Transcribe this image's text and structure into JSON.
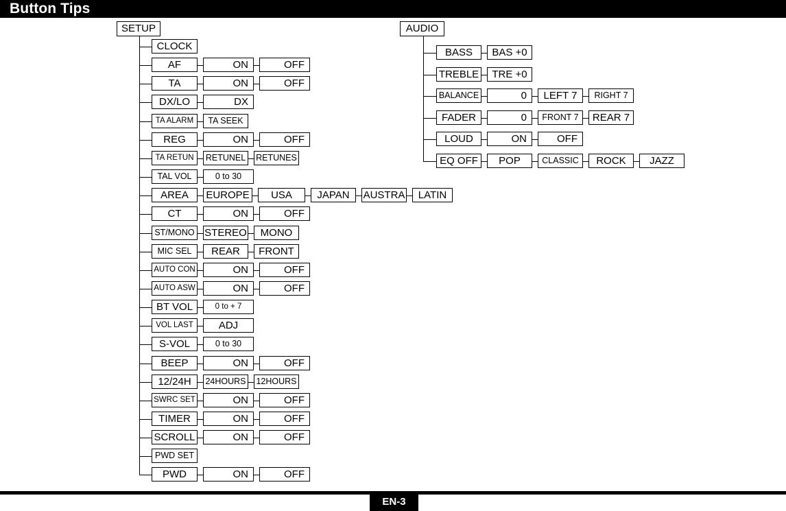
{
  "header": {
    "title": "Button Tips"
  },
  "footer": {
    "page_label": "EN-3"
  },
  "colors": {
    "ink": "#000000",
    "paper": "#ffffff"
  },
  "setup_tree": {
    "root": "SETUP",
    "rows": [
      {
        "label": "CLOCK",
        "options": []
      },
      {
        "label": "AF",
        "options": [
          "ON",
          "OFF"
        ]
      },
      {
        "label": "TA",
        "options": [
          "ON",
          "OFF"
        ]
      },
      {
        "label": "DX/LO",
        "options": [
          "DX"
        ]
      },
      {
        "label": "TA ALARM",
        "options": [
          "TA SEEK"
        ]
      },
      {
        "label": "REG",
        "options": [
          "ON",
          "OFF"
        ]
      },
      {
        "label": "TA RETUN",
        "options": [
          "RETUNEL",
          "RETUNES"
        ]
      },
      {
        "label": "TAL VOL",
        "options": [
          "0 to 30"
        ]
      },
      {
        "label": "AREA",
        "options": [
          "EUROPE",
          "USA",
          "JAPAN",
          "AUSTRA",
          "LATIN"
        ]
      },
      {
        "label": "CT",
        "options": [
          "ON",
          "OFF"
        ]
      },
      {
        "label": "ST/MONO",
        "options": [
          "STEREO",
          "MONO"
        ]
      },
      {
        "label": "MIC SEL",
        "options": [
          "REAR",
          "FRONT"
        ]
      },
      {
        "label": "AUTO CON",
        "options": [
          "ON",
          "OFF"
        ]
      },
      {
        "label": "AUTO ASW",
        "options": [
          "ON",
          "OFF"
        ]
      },
      {
        "label": "BT VOL",
        "options": [
          "0 to + 7"
        ]
      },
      {
        "label": "VOL LAST",
        "options": [
          "ADJ"
        ]
      },
      {
        "label": "S-VOL",
        "options": [
          "0 to 30"
        ]
      },
      {
        "label": "BEEP",
        "options": [
          "ON",
          "OFF"
        ]
      },
      {
        "label": "12/24H",
        "options": [
          "24HOURS",
          "12HOURS"
        ]
      },
      {
        "label": "SWRC SET",
        "options": [
          "ON",
          "OFF"
        ]
      },
      {
        "label": "TIMER",
        "options": [
          "ON",
          "OFF"
        ]
      },
      {
        "label": "SCROLL",
        "options": [
          "ON",
          "OFF"
        ]
      },
      {
        "label": "PWD SET",
        "options": []
      },
      {
        "label": "PWD",
        "options": [
          "ON",
          "OFF"
        ]
      }
    ]
  },
  "audio_tree": {
    "root": "AUDIO",
    "rows": [
      {
        "label": "BASS",
        "options": [
          "BAS +0"
        ]
      },
      {
        "label": "TREBLE",
        "options": [
          "TRE +0"
        ]
      },
      {
        "label": "BALANCE",
        "options": [
          "0",
          "LEFT 7",
          "RIGHT 7"
        ]
      },
      {
        "label": "FADER",
        "options": [
          "0",
          "FRONT 7",
          "REAR 7"
        ]
      },
      {
        "label": "LOUD",
        "options": [
          "ON",
          "OFF"
        ]
      },
      {
        "label": "EQ OFF",
        "options": [
          "POP",
          "CLASSIC",
          "ROCK",
          "JAZZ"
        ]
      }
    ]
  }
}
